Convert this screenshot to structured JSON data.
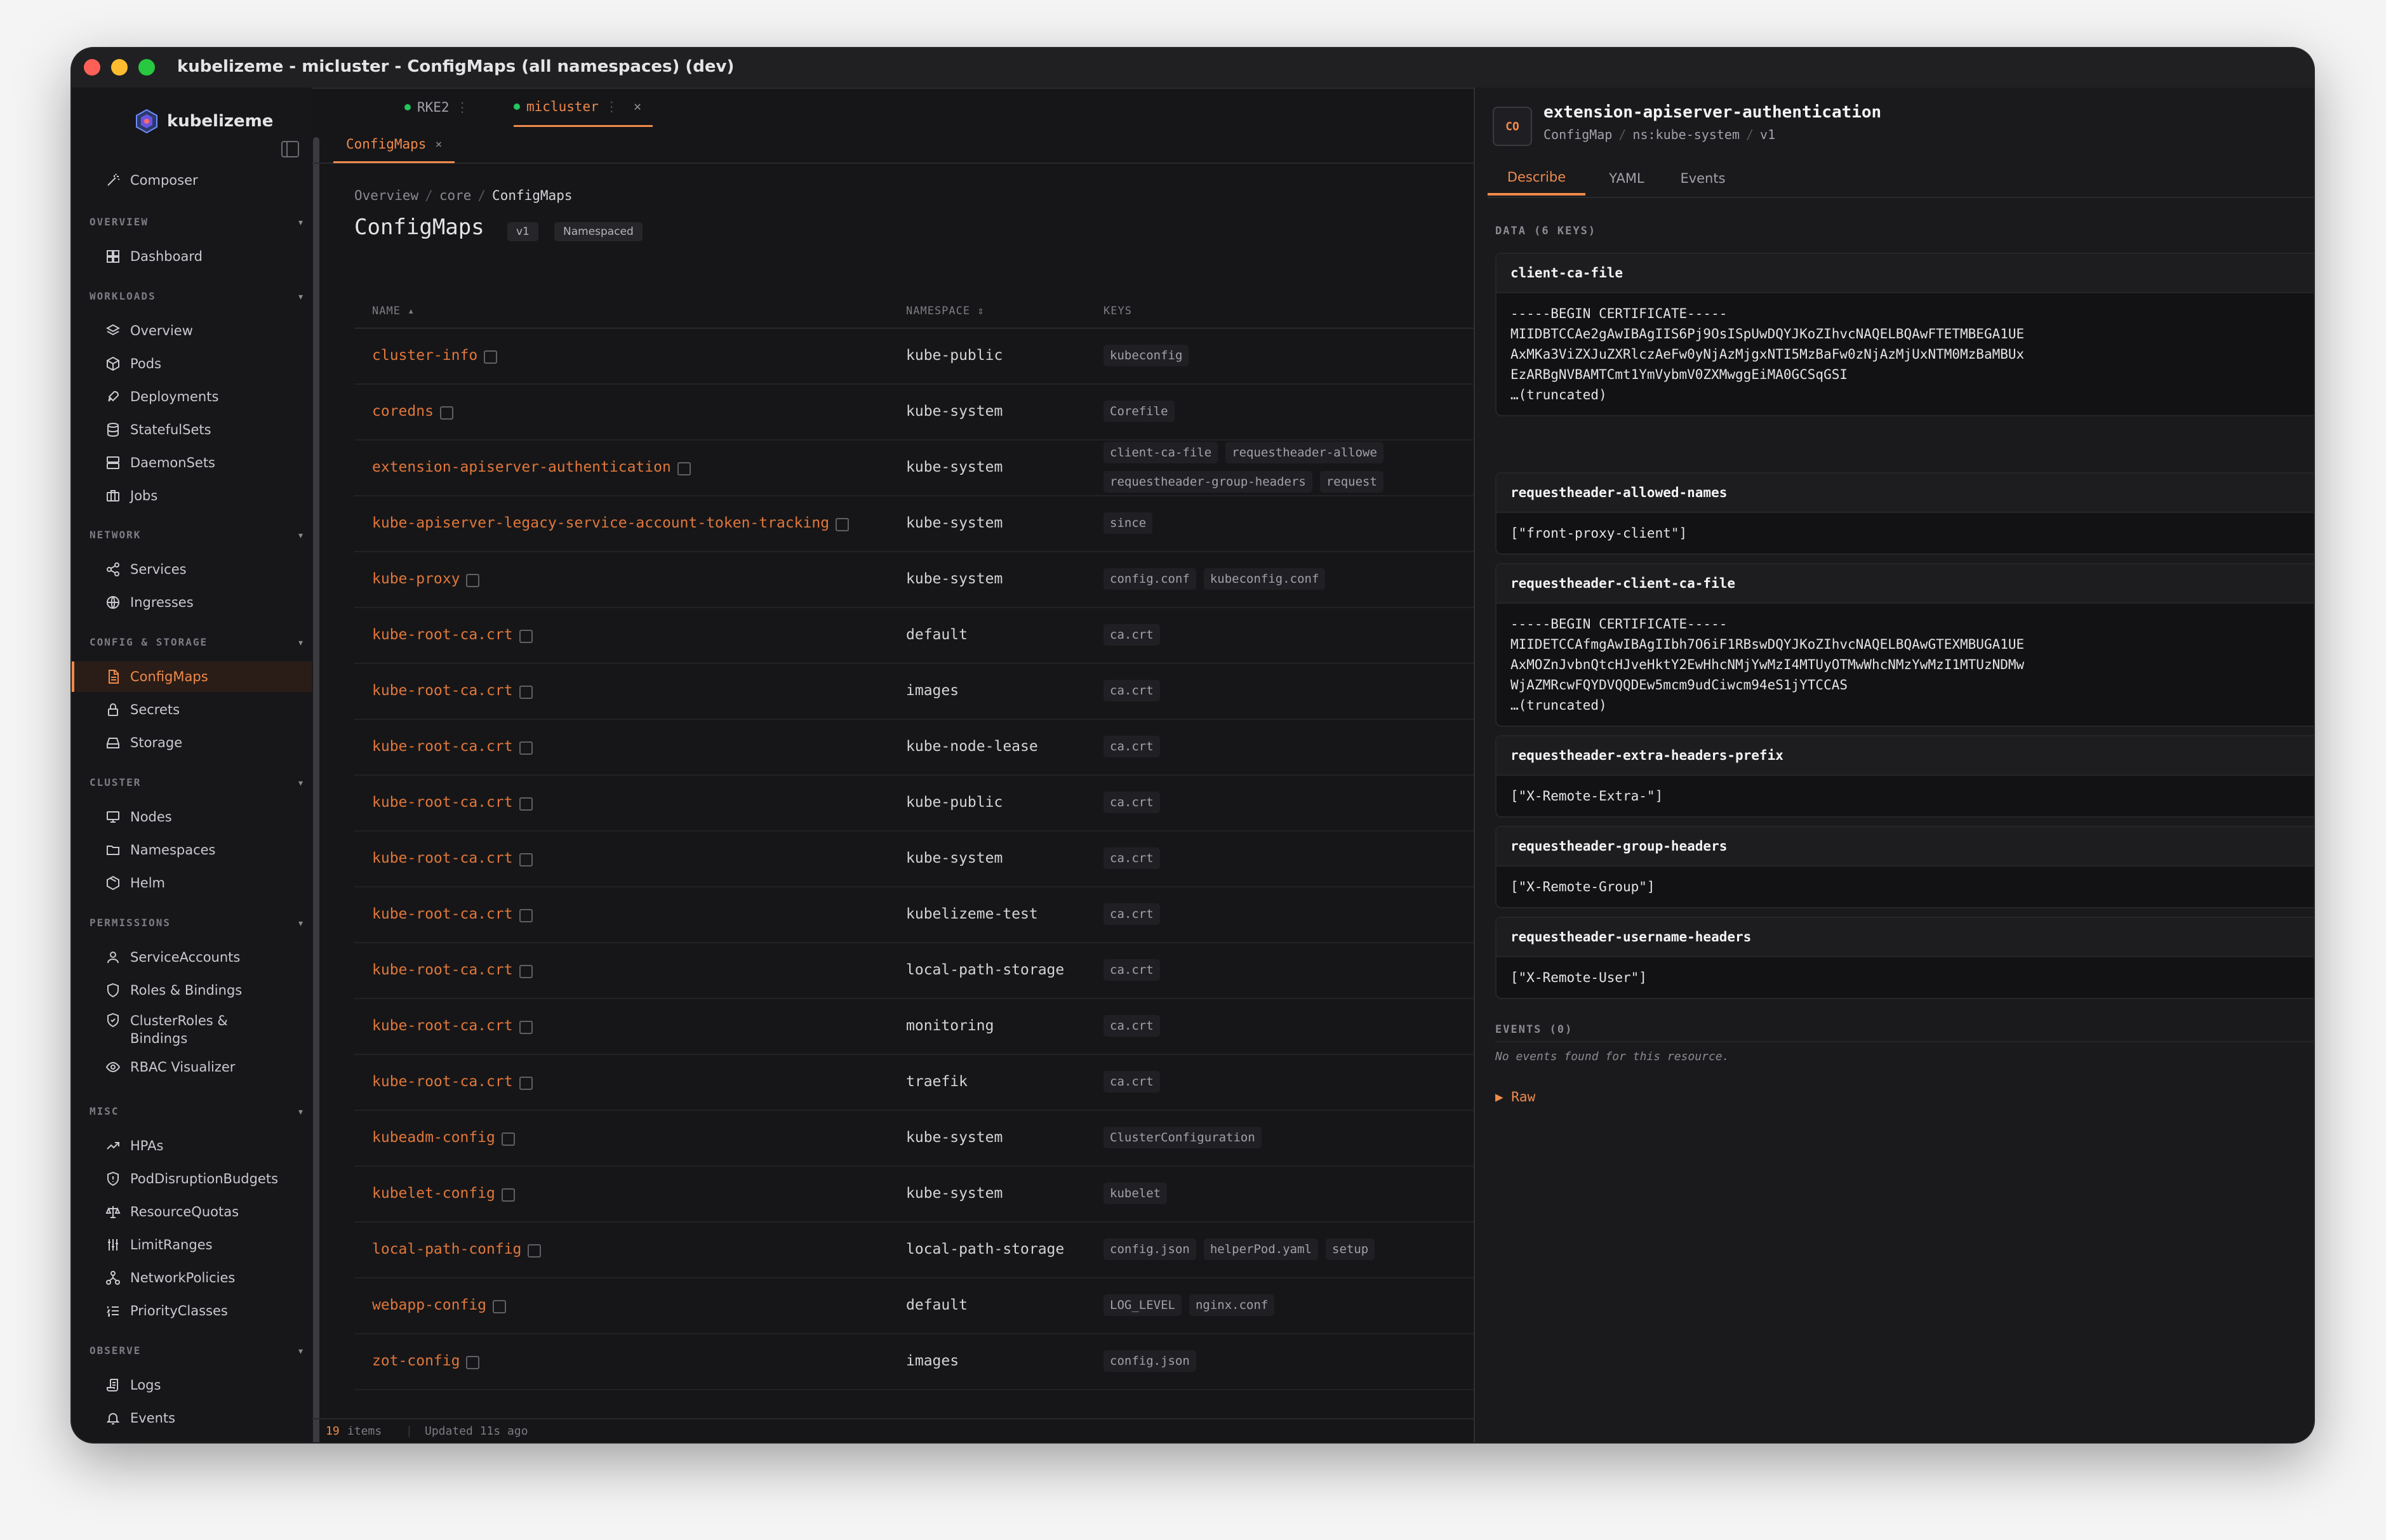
{
  "window": {
    "title": "kubelizeme - micluster - ConfigMaps (all namespaces) (dev)"
  },
  "brand": {
    "name": "kubelizeme"
  },
  "top_tabs": [
    {
      "label": "RKE2",
      "sep": "⋮"
    },
    {
      "label": "micluster",
      "sep": "⋮",
      "close": "×"
    }
  ],
  "sub_tab": {
    "label": "ConfigMaps",
    "close": "×"
  },
  "sidebar": {
    "composer": {
      "label": "Composer",
      "icon": "wand-icon"
    },
    "sections": {
      "overview": {
        "title": "OVERVIEW",
        "items": [
          {
            "label": "Dashboard",
            "icon": "grid-icon"
          }
        ]
      },
      "workloads": {
        "title": "WORKLOADS",
        "items": [
          {
            "label": "Overview",
            "icon": "layers-icon"
          },
          {
            "label": "Pods",
            "icon": "cube-icon"
          },
          {
            "label": "Deployments",
            "icon": "rocket-icon"
          },
          {
            "label": "StatefulSets",
            "icon": "database-icon"
          },
          {
            "label": "DaemonSets",
            "icon": "server-icon"
          },
          {
            "label": "Jobs",
            "icon": "briefcase-icon"
          }
        ]
      },
      "network": {
        "title": "NETWORK",
        "items": [
          {
            "label": "Services",
            "icon": "share-icon"
          },
          {
            "label": "Ingresses",
            "icon": "globe-icon"
          }
        ]
      },
      "config": {
        "title": "CONFIG & STORAGE",
        "items": [
          {
            "label": "ConfigMaps",
            "icon": "file-icon"
          },
          {
            "label": "Secrets",
            "icon": "lock-icon"
          },
          {
            "label": "Storage",
            "icon": "drive-icon"
          }
        ]
      },
      "cluster": {
        "title": "CLUSTER",
        "items": [
          {
            "label": "Nodes",
            "icon": "monitor-icon"
          },
          {
            "label": "Namespaces",
            "icon": "folder-icon"
          },
          {
            "label": "Helm",
            "icon": "package-icon"
          }
        ]
      },
      "permissions": {
        "title": "PERMISSIONS",
        "items": [
          {
            "label": "ServiceAccounts",
            "icon": "user-icon"
          },
          {
            "label": "Roles & Bindings",
            "icon": "shield-icon"
          },
          {
            "label": "ClusterRoles & Bindings",
            "icon": "shield-check-icon"
          },
          {
            "label": "RBAC Visualizer",
            "icon": "eye-icon"
          }
        ]
      },
      "misc": {
        "title": "MISC",
        "items": [
          {
            "label": "HPAs",
            "icon": "trending-up-icon"
          },
          {
            "label": "PodDisruptionBudgets",
            "icon": "shield-alert-icon"
          },
          {
            "label": "ResourceQuotas",
            "icon": "scale-icon"
          },
          {
            "label": "LimitRanges",
            "icon": "sliders-icon"
          },
          {
            "label": "NetworkPolicies",
            "icon": "network-icon"
          },
          {
            "label": "PriorityClasses",
            "icon": "list-ordered-icon"
          }
        ]
      },
      "observe": {
        "title": "OBSERVE",
        "items": [
          {
            "label": "Logs",
            "icon": "scroll-icon"
          },
          {
            "label": "Events",
            "icon": "bell-icon"
          }
        ]
      }
    }
  },
  "breadcrumb": [
    "Overview",
    "core",
    "ConfigMaps"
  ],
  "breadcrumb_sep": "/",
  "page": {
    "title": "ConfigMaps",
    "version": "v1",
    "scope": "Namespaced"
  },
  "table": {
    "columns": {
      "name": "NAME ▴",
      "namespace": "NAMESPACE ⇕",
      "keys": "KEYS"
    },
    "rows": [
      {
        "name": "cluster-info",
        "namespace": "kube-public",
        "keys": [
          "kubeconfig"
        ]
      },
      {
        "name": "coredns",
        "namespace": "kube-system",
        "keys": [
          "Corefile"
        ]
      },
      {
        "name": "extension-apiserver-authentication",
        "namespace": "kube-system",
        "keys": [
          "client-ca-file",
          "requestheader-allowe",
          "requestheader-group-headers",
          "request"
        ]
      },
      {
        "name": "kube-apiserver-legacy-service-account-token-tracking",
        "namespace": "kube-system",
        "keys": [
          "since"
        ]
      },
      {
        "name": "kube-proxy",
        "namespace": "kube-system",
        "keys": [
          "config.conf",
          "kubeconfig.conf"
        ]
      },
      {
        "name": "kube-root-ca.crt",
        "namespace": "default",
        "keys": [
          "ca.crt"
        ]
      },
      {
        "name": "kube-root-ca.crt",
        "namespace": "images",
        "keys": [
          "ca.crt"
        ]
      },
      {
        "name": "kube-root-ca.crt",
        "namespace": "kube-node-lease",
        "keys": [
          "ca.crt"
        ]
      },
      {
        "name": "kube-root-ca.crt",
        "namespace": "kube-public",
        "keys": [
          "ca.crt"
        ]
      },
      {
        "name": "kube-root-ca.crt",
        "namespace": "kube-system",
        "keys": [
          "ca.crt"
        ]
      },
      {
        "name": "kube-root-ca.crt",
        "namespace": "kubelizeme-test",
        "keys": [
          "ca.crt"
        ]
      },
      {
        "name": "kube-root-ca.crt",
        "namespace": "local-path-storage",
        "keys": [
          "ca.crt"
        ]
      },
      {
        "name": "kube-root-ca.crt",
        "namespace": "monitoring",
        "keys": [
          "ca.crt"
        ]
      },
      {
        "name": "kube-root-ca.crt",
        "namespace": "traefik",
        "keys": [
          "ca.crt"
        ]
      },
      {
        "name": "kubeadm-config",
        "namespace": "kube-system",
        "keys": [
          "ClusterConfiguration"
        ]
      },
      {
        "name": "kubelet-config",
        "namespace": "kube-system",
        "keys": [
          "kubelet"
        ]
      },
      {
        "name": "local-path-config",
        "namespace": "local-path-storage",
        "keys": [
          "config.json",
          "helperPod.yaml",
          "setup"
        ]
      },
      {
        "name": "webapp-config",
        "namespace": "default",
        "keys": [
          "LOG_LEVEL",
          "nginx.conf"
        ]
      },
      {
        "name": "zot-config",
        "namespace": "images",
        "keys": [
          "config.json"
        ]
      }
    ]
  },
  "footer": {
    "count": "19",
    "items_label": "items",
    "updated": "Updated 11s ago"
  },
  "panel": {
    "icon_text": "CO",
    "title": "extension-apiserver-authentication",
    "kind": "ConfigMap",
    "namespace": "ns:kube-system",
    "version": "v1",
    "tabs": [
      "Describe",
      "YAML",
      "Events"
    ],
    "data_label": "DATA (6 KEYS)",
    "entries": [
      {
        "key": "client-ca-file",
        "value": "-----BEGIN CERTIFICATE-----\nMIIDBTCCAe2gAwIBAgIIS6Pj9OsISpUwDQYJKoZIhvcNAQELBQAwFTETMBEGA1UE\nAxMKa3ViZXJuZXRlczAeFw0yNjAzMjgxNTI5MzBaFw0zNjAzMjUxNTM0MzBaMBUx\nEzARBgNVBAMTCmt1YmVybmV0ZXMwggEiMA0GCSqGSI\n…(truncated)"
      },
      {
        "key": "requestheader-allowed-names",
        "value": "[\"front-proxy-client\"]"
      },
      {
        "key": "requestheader-client-ca-file",
        "value": "-----BEGIN CERTIFICATE-----\nMIIDETCCAfmgAwIBAgIIbh7O6iF1RBswDQYJKoZIhvcNAQELBQAwGTEXMBUGA1UE\nAxMOZnJvbnQtcHJveHktY2EwHhcNMjYwMzI4MTUyOTMwWhcNMzYwMzI1MTUzNDMw\nWjAZMRcwFQYDVQQDEw5mcm9udCiwcm94eS1jYTCCAS\n…(truncated)"
      },
      {
        "key": "requestheader-extra-headers-prefix",
        "value": "[\"X-Remote-Extra-\"]"
      },
      {
        "key": "requestheader-group-headers",
        "value": "[\"X-Remote-Group\"]"
      },
      {
        "key": "requestheader-username-headers",
        "value": "[\"X-Remote-User\"]"
      }
    ],
    "events_label": "EVENTS (0)",
    "no_events": "No events found for this resource.",
    "raw_label": "▶ Raw"
  },
  "colors": {
    "accent": "#f08a4b",
    "link": "#e0773b",
    "bg": "#161618",
    "active_dot": "#22c55e"
  }
}
